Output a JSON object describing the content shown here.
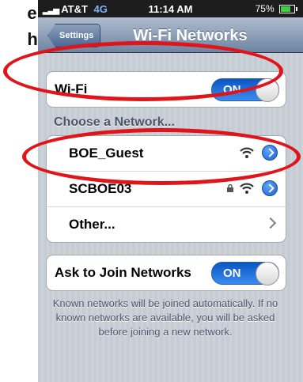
{
  "slide": {
    "side_text_1": "en",
    "side_text_2": "he"
  },
  "statusbar": {
    "carrier": "AT&T",
    "network": "4G",
    "time": "11:14 AM",
    "battery": "75%"
  },
  "navbar": {
    "back_label": "Settings",
    "title": "Wi-Fi Networks"
  },
  "wifi_group": {
    "label": "Wi-Fi",
    "toggle_label": "ON"
  },
  "networks": {
    "header": "Choose a Network...",
    "items": [
      {
        "name": "BOE_Guest",
        "secured": false
      },
      {
        "name": "SCBOE03",
        "secured": true
      },
      {
        "name": "Other..."
      }
    ]
  },
  "ask_group": {
    "label": "Ask to Join Networks",
    "toggle_label": "ON"
  },
  "footer": {
    "text": "Known networks will be joined automatically. If no known networks are available, you will be asked before joining a new network."
  },
  "colors": {
    "annotation": "#e0141b",
    "toggle_on": "#1a6fe0"
  }
}
